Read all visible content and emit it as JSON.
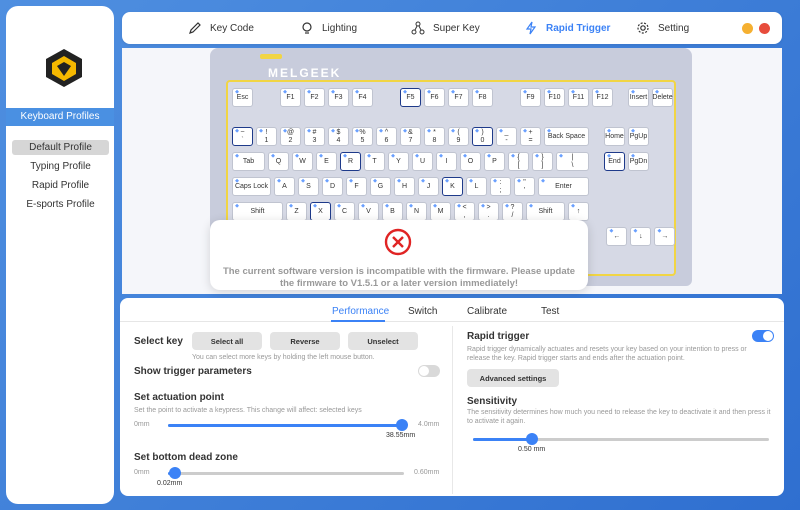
{
  "nav": {
    "items": [
      {
        "label": "Key Code",
        "icon": "pen-icon"
      },
      {
        "label": "Lighting",
        "icon": "lightbulb-icon"
      },
      {
        "label": "Super Key",
        "icon": "nodes-icon"
      },
      {
        "label": "Rapid Trigger",
        "icon": "lightning-icon"
      },
      {
        "label": "Setting",
        "icon": "gear-icon"
      }
    ],
    "active": "Rapid Trigger"
  },
  "sidebar": {
    "header": "Keyboard Profiles",
    "profiles": [
      "Default Profile",
      "Typing Profile",
      "Rapid Profile",
      "E-sports Profile"
    ],
    "active": "Default Profile"
  },
  "keyboard": {
    "brand": "MELGEEK",
    "rows": [
      [
        "Esc",
        "F1",
        "F2",
        "F3",
        "F4",
        "F5",
        "F6",
        "F7",
        "F8",
        "F9",
        "F10",
        "F11",
        "F12",
        "Insert",
        "Delete"
      ],
      [
        "~\n`",
        "!\n1",
        "@\n2",
        "#\n3",
        "$\n4",
        "%\n5",
        "^\n6",
        "&\n7",
        "*\n8",
        "(\n9",
        ")\n0",
        "_\n-",
        "+\n=",
        "Back Space",
        "Home",
        "PgUp"
      ],
      [
        "Tab",
        "Q",
        "W",
        "E",
        "R",
        "T",
        "Y",
        "U",
        "I",
        "O",
        "P",
        "{\n[",
        "}\n]",
        "|\n\\",
        "End",
        "PgDn"
      ],
      [
        "Caps Lock",
        "A",
        "S",
        "D",
        "F",
        "G",
        "H",
        "J",
        "K",
        "L",
        ":\n;",
        "\"\n'",
        "Enter"
      ],
      [
        "Shift",
        "Z",
        "X",
        "C",
        "V",
        "B",
        "N",
        "M",
        "<\n,",
        ">\n.",
        "?\n/",
        "Shift",
        "↑"
      ],
      [
        "←",
        "↓",
        "→"
      ]
    ],
    "selected": [
      "F5",
      "~\n`",
      ")\n0",
      "R",
      "K",
      "End",
      "X"
    ]
  },
  "dialog": {
    "message": "The current software version is incompatible with the firmware. Please update the firmware to V1.5.1 or a later version immediately!"
  },
  "tabs": [
    "Performance",
    "Switch",
    "Calibrate",
    "Test"
  ],
  "active_tab": "Performance",
  "left": {
    "select_key_label": "Select key",
    "select_all": "Select all",
    "reverse": "Reverse",
    "unselect": "Unselect",
    "select_hint": "You can select more keys by holding the left mouse button.",
    "show_trigger": "Show trigger parameters",
    "show_trigger_on": false,
    "actuation_label": "Set actuation point",
    "actuation_desc": "Set the point to activate a keypress. This change will affect: selected keys",
    "actuation_min": "0mm",
    "actuation_max": "4.0mm",
    "actuation_value": "38.55mm",
    "actuation_fraction": 0.99,
    "deadzone_label": "Set bottom dead zone",
    "deadzone_min": "0mm",
    "deadzone_max": "0.60mm",
    "deadzone_value": "0.02mm",
    "deadzone_fraction": 0.03
  },
  "right": {
    "rapid_label": "Rapid trigger",
    "rapid_on": true,
    "rapid_desc": "Rapid trigger dynamically actuates and resets your key based on your intention to press or release the key. Rapid trigger starts and ends after the actuation point.",
    "advanced": "Advanced settings",
    "sensitivity_label": "Sensitivity",
    "sensitivity_desc": "The sensitivity determines how much you need to release the key to deactivate it and then press it to activate it again.",
    "sensitivity_value": "0.50 mm",
    "sensitivity_fraction": 0.2
  },
  "colors": {
    "accent": "#3b82f6",
    "yellow": "#f1d544",
    "close": "#e74c3c",
    "minimize": "#f5b031"
  }
}
